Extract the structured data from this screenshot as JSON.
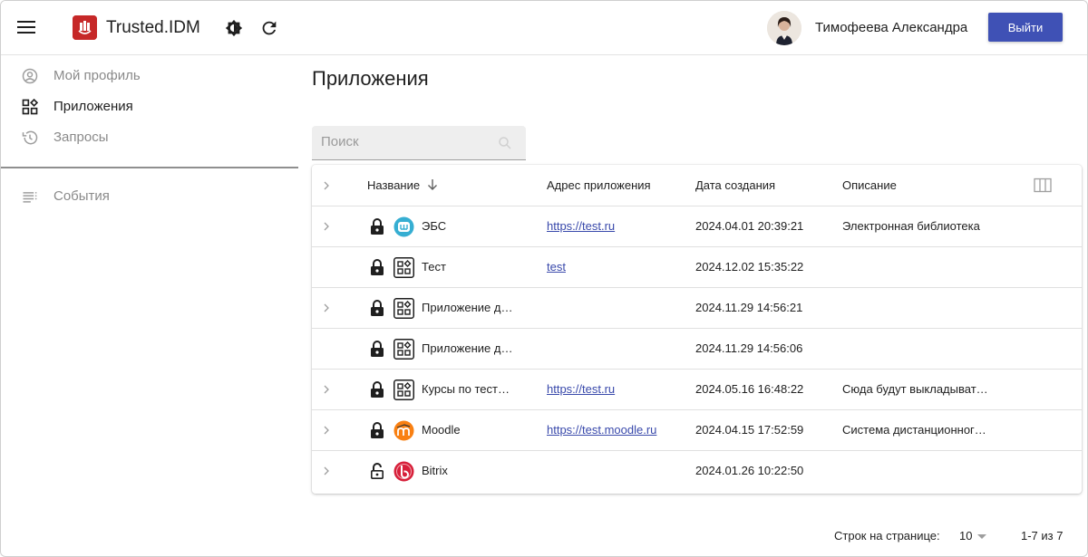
{
  "header": {
    "app_title": "Trusted.IDM",
    "user_name": "Тимофеева Александра",
    "logout_label": "Выйти",
    "brand_color": "#c62828",
    "accent_color": "#3f51b5"
  },
  "sidebar": {
    "items": [
      {
        "label": "Мой профиль",
        "icon": "account-circle-icon",
        "state": "muted"
      },
      {
        "label": "Приложения",
        "icon": "apps-grid-icon",
        "state": "active"
      },
      {
        "label": "Запросы",
        "icon": "history-icon",
        "state": "muted"
      },
      {
        "label": "События",
        "icon": "list-icon",
        "state": "muted"
      }
    ]
  },
  "main": {
    "title": "Приложения",
    "search_placeholder": "Поиск",
    "table": {
      "headers": {
        "name": "Название",
        "address": "Адрес приложения",
        "created": "Дата создания",
        "description": "Описание"
      },
      "rows": [
        {
          "expandable": true,
          "locked": true,
          "icon": "ebs-icon",
          "name": "ЭБС",
          "address": "https://test.ru",
          "created": "2024.04.01 20:39:21",
          "description": "Электронная библиотека"
        },
        {
          "expandable": false,
          "locked": true,
          "icon": "apps-grid-icon",
          "name": "Тест",
          "address": "test",
          "created": "2024.12.02 15:35:22",
          "description": ""
        },
        {
          "expandable": true,
          "locked": true,
          "icon": "apps-grid-icon",
          "name": "Приложение д…",
          "address": "",
          "created": "2024.11.29 14:56:21",
          "description": ""
        },
        {
          "expandable": false,
          "locked": true,
          "icon": "apps-grid-icon",
          "name": "Приложение д…",
          "address": "",
          "created": "2024.11.29 14:56:06",
          "description": ""
        },
        {
          "expandable": true,
          "locked": true,
          "icon": "apps-grid-icon",
          "name": "Курсы по тест…",
          "address": "https://test.ru",
          "created": "2024.05.16 16:48:22",
          "description": "Сюда будут выкладыват…"
        },
        {
          "expandable": true,
          "locked": true,
          "icon": "moodle-icon",
          "name": "Moodle",
          "address": "https://test.moodle.ru",
          "created": "2024.04.15 17:52:59",
          "description": "Система дистанционног…"
        },
        {
          "expandable": true,
          "locked": false,
          "icon": "bitrix-icon",
          "name": "Bitrix",
          "address": "",
          "created": "2024.01.26 10:22:50",
          "description": ""
        }
      ]
    },
    "pagination": {
      "rows_per_page_label": "Строк на странице:",
      "rows_per_page_value": "10",
      "range": "1-7 из 7"
    }
  }
}
